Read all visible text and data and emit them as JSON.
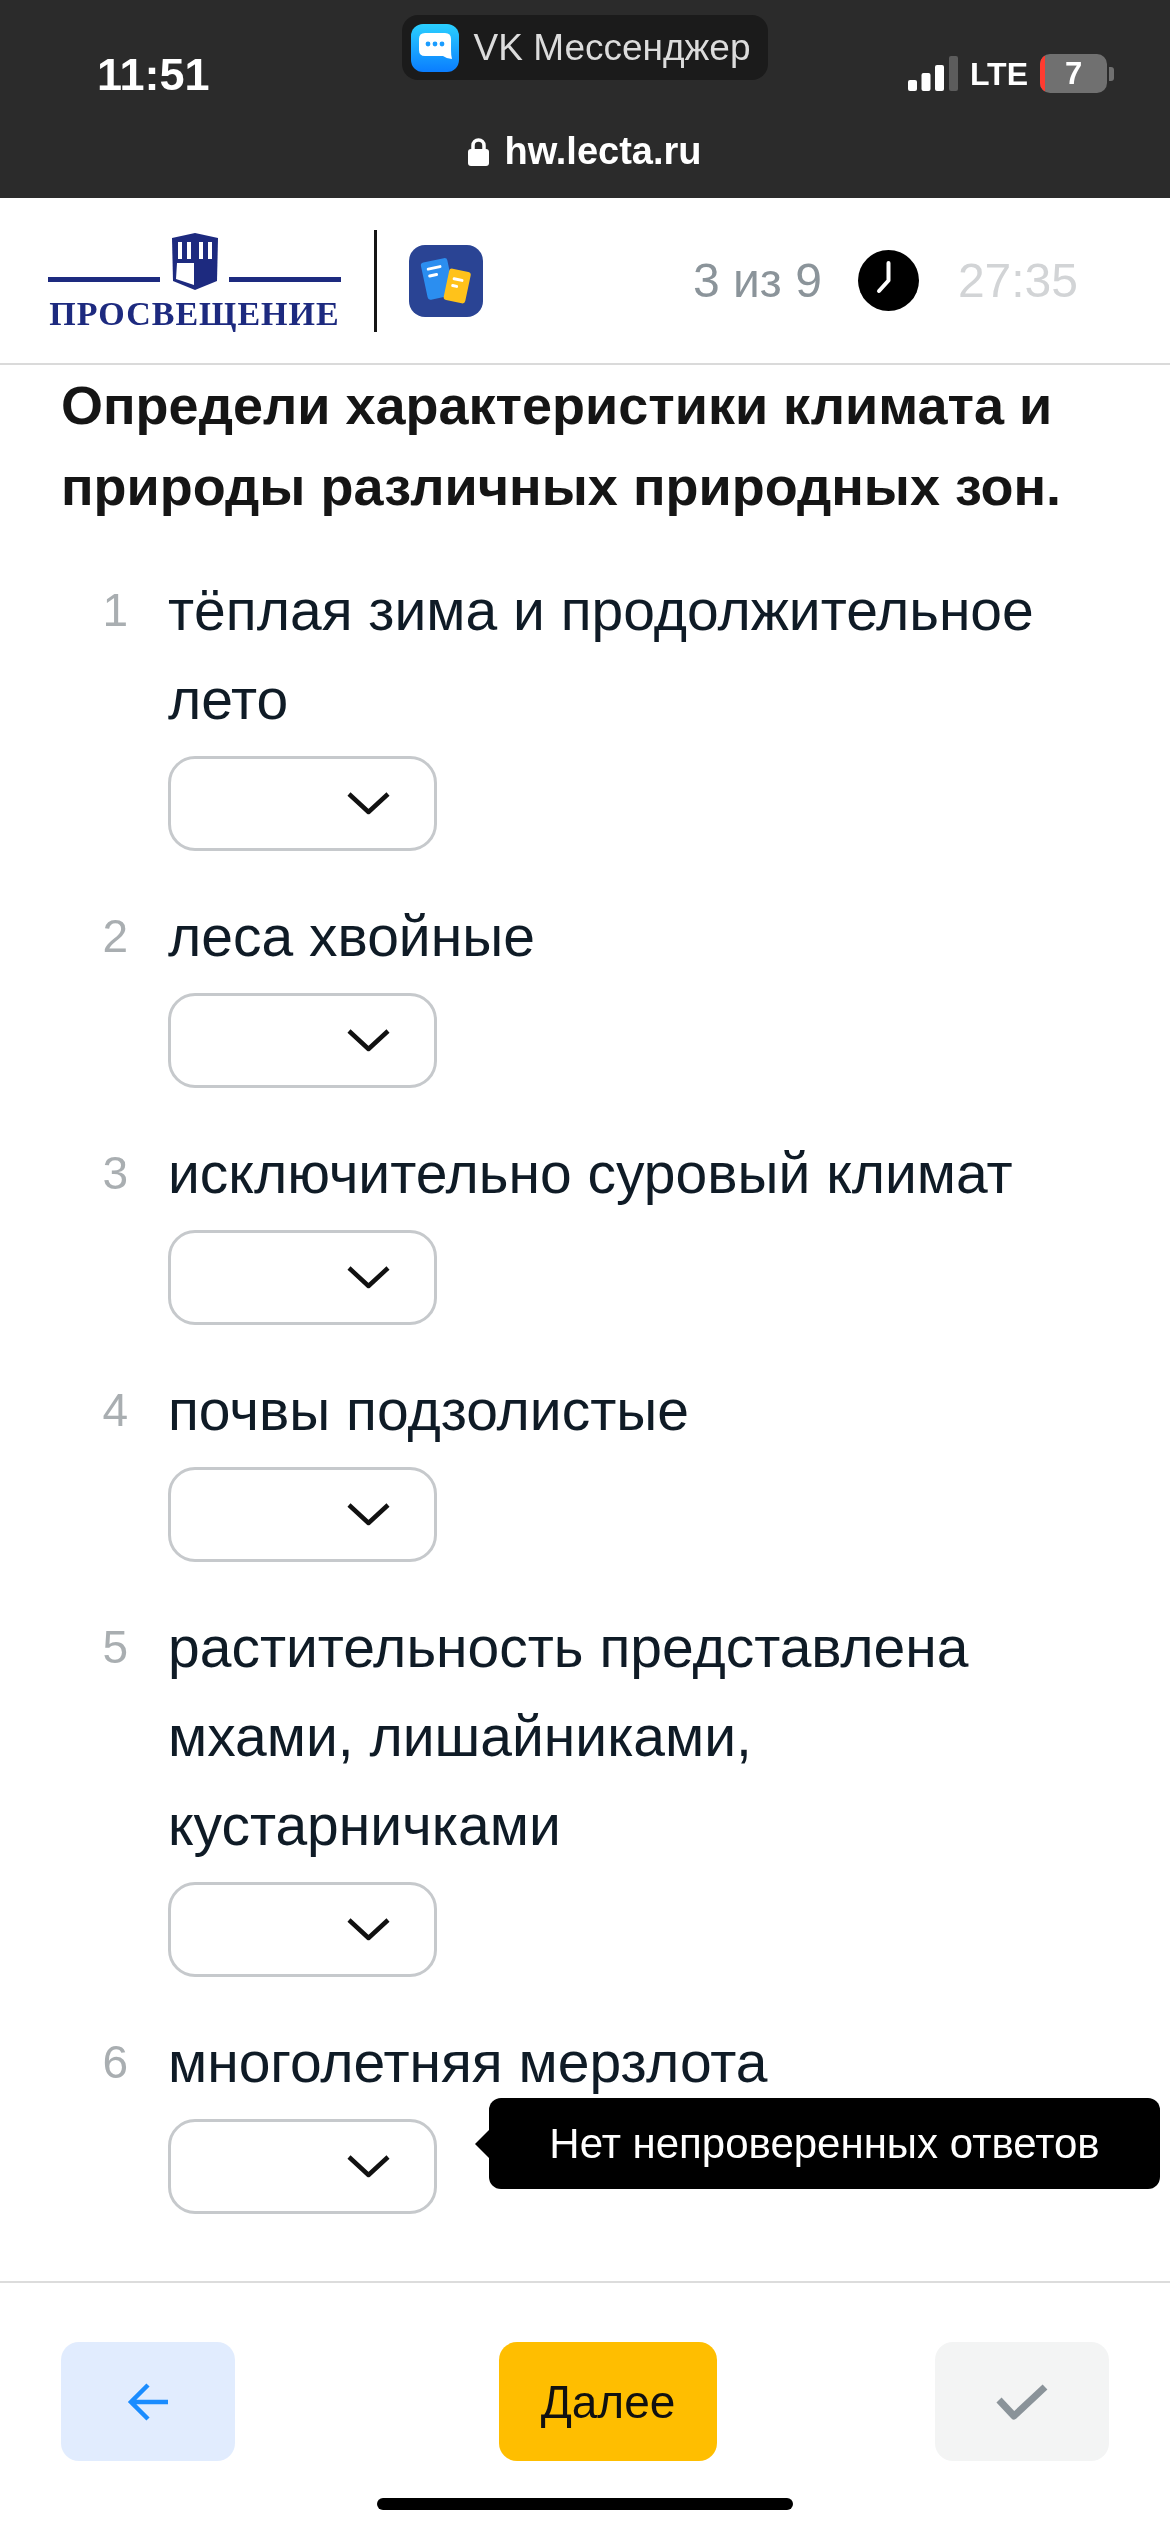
{
  "status_bar": {
    "time": "11:51",
    "app_pill": "VK Мессенджер",
    "network": "LTE",
    "battery": "7",
    "url": "hw.lecta.ru"
  },
  "header": {
    "logo_text": "ПРОСВЕЩЕНИЕ",
    "progress": "3 из 9",
    "timer": "27:35"
  },
  "question": {
    "title": "Определи характеристики климата и природы различных природных зон.",
    "items": [
      {
        "number": "1",
        "text": "тёплая зима и продолжительное лето"
      },
      {
        "number": "2",
        "text": "леса хвойные"
      },
      {
        "number": "3",
        "text": "исключительно суровый климат"
      },
      {
        "number": "4",
        "text": "почвы подзолистые"
      },
      {
        "number": "5",
        "text": "растительность представлена мхами, лишайниками, кустарничками"
      },
      {
        "number": "6",
        "text": "многолетняя мерзлота"
      }
    ]
  },
  "tooltip": {
    "text": "Нет непроверенных ответов"
  },
  "footer": {
    "buttons": [
      {
        "kind": "back",
        "disabled": false
      },
      {
        "kind": "next",
        "label": "Далее",
        "disabled": false
      },
      {
        "kind": "check",
        "disabled": true
      }
    ]
  }
}
